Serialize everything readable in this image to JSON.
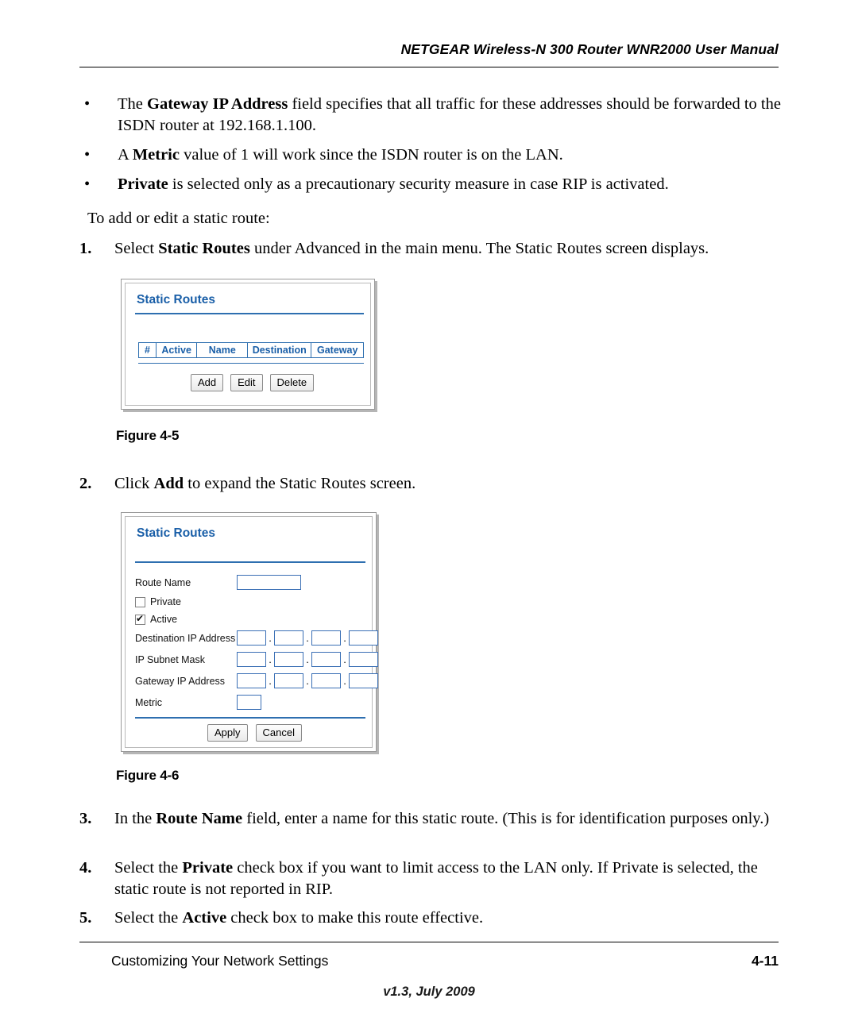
{
  "header": {
    "title": "NETGEAR Wireless-N 300 Router WNR2000 User Manual"
  },
  "bullets": [
    {
      "marker": "•",
      "segments": [
        {
          "text": "The ",
          "bold": false
        },
        {
          "text": "Gateway IP Address",
          "bold": true
        },
        {
          "text": " field specifies that all traffic for these addresses should be forwarded to the ISDN router at 192.168.1.100.",
          "bold": false
        }
      ]
    },
    {
      "marker": "•",
      "segments": [
        {
          "text": "A ",
          "bold": false
        },
        {
          "text": "Metric",
          "bold": true
        },
        {
          "text": " value of 1 will work since the ISDN router is on the LAN.",
          "bold": false
        }
      ]
    },
    {
      "marker": "•",
      "segments": [
        {
          "text": "Private",
          "bold": true
        },
        {
          "text": " is selected only as a precautionary security measure in case RIP is activated.",
          "bold": false
        }
      ]
    }
  ],
  "intro_line": "To add or edit a static route:",
  "steps": [
    {
      "num": "1.",
      "segments": [
        {
          "text": "Select ",
          "bold": false
        },
        {
          "text": "Static Routes",
          "bold": true
        },
        {
          "text": " under Advanced in the main menu. The Static Routes screen displays.",
          "bold": false
        }
      ]
    },
    {
      "num": "2.",
      "segments": [
        {
          "text": "Click ",
          "bold": false
        },
        {
          "text": "Add",
          "bold": true
        },
        {
          "text": " to expand the Static Routes screen.",
          "bold": false
        }
      ]
    },
    {
      "num": "3.",
      "segments": [
        {
          "text": "In the ",
          "bold": false
        },
        {
          "text": "Route Name",
          "bold": true
        },
        {
          "text": " field, enter a name for this static route. (This is for identification purposes only.)",
          "bold": false
        }
      ]
    },
    {
      "num": "4.",
      "segments": [
        {
          "text": "Select the ",
          "bold": false
        },
        {
          "text": "Private",
          "bold": true
        },
        {
          "text": " check box if you want to limit access to the LAN only. If Private is selected, the static route is not reported in RIP.",
          "bold": false
        }
      ]
    },
    {
      "num": "5.",
      "segments": [
        {
          "text": "Select the ",
          "bold": false
        },
        {
          "text": "Active",
          "bold": true
        },
        {
          "text": " check box to make this route effective.",
          "bold": false
        }
      ]
    }
  ],
  "figures": [
    {
      "caption": "Figure 4-5",
      "screen": {
        "title": "Static Routes",
        "table_headers": [
          "#",
          "Active",
          "Name",
          "Destination",
          "Gateway"
        ],
        "buttons": [
          "Add",
          "Edit",
          "Delete"
        ]
      }
    },
    {
      "caption": "Figure 4-6",
      "screen": {
        "title": "Static Routes",
        "fields": [
          {
            "label": "Route Name",
            "type": "text",
            "value": ""
          },
          {
            "label": "Private",
            "type": "checkbox",
            "checked": false
          },
          {
            "label": "Active",
            "type": "checkbox",
            "checked": true
          },
          {
            "label": "Destination IP Address",
            "type": "ip",
            "value": [
              "",
              "",
              "",
              ""
            ]
          },
          {
            "label": "IP Subnet Mask",
            "type": "ip",
            "value": [
              "",
              "",
              "",
              ""
            ]
          },
          {
            "label": "Gateway IP Address",
            "type": "ip",
            "value": [
              "",
              "",
              "",
              ""
            ]
          },
          {
            "label": "Metric",
            "type": "text-small",
            "value": ""
          }
        ],
        "buttons": [
          "Apply",
          "Cancel"
        ]
      }
    }
  ],
  "footer": {
    "left": "Customizing Your Network Settings",
    "right": "4-11",
    "version": "v1.3, July 2009"
  },
  "colors": {
    "accent_blue": "#1a5fa8",
    "field_border": "#3a6fb5"
  }
}
